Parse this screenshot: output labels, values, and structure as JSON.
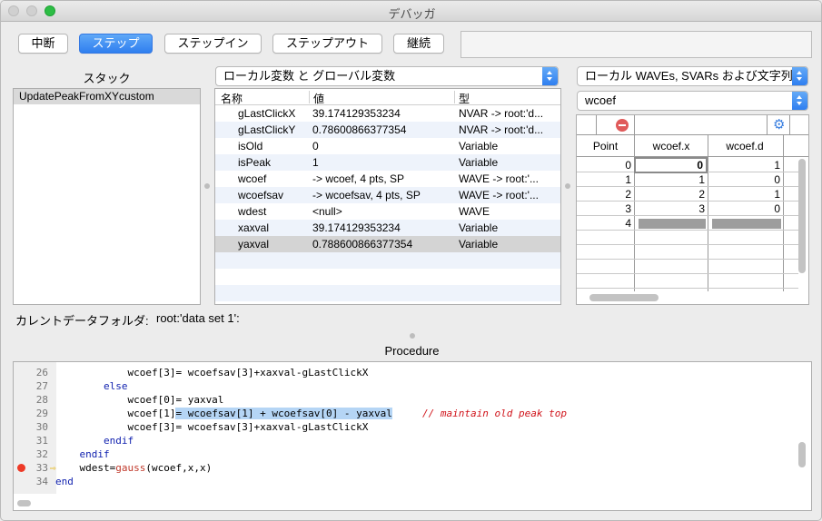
{
  "window": {
    "title": "デバッガ"
  },
  "toolbar": {
    "break_label": "中断",
    "step_label": "ステップ",
    "step_in_label": "ステップイン",
    "step_out_label": "ステップアウト",
    "continue_label": "継続",
    "message": ""
  },
  "stack": {
    "title": "スタック",
    "items": [
      "UpdatePeakFromXYcustom"
    ]
  },
  "variables": {
    "scope_popup": "ローカル変数 と グローバル変数",
    "columns": {
      "name": "名称",
      "value": "値",
      "type": "型"
    },
    "rows": [
      {
        "name": "gLastClickX",
        "value": "39.174129353234",
        "type": "NVAR -> root:'d..."
      },
      {
        "name": "gLastClickY",
        "value": "0.78600866377354",
        "type": "NVAR -> root:'d..."
      },
      {
        "name": "isOld",
        "value": "0",
        "type": "Variable"
      },
      {
        "name": "isPeak",
        "value": "1",
        "type": "Variable"
      },
      {
        "name": "wcoef",
        "value": "-> wcoef, 4 pts, SP",
        "type": "WAVE -> root:'..."
      },
      {
        "name": "wcoefsav",
        "value": "-> wcoefsav, 4 pts, SP",
        "type": "WAVE -> root:'..."
      },
      {
        "name": "wdest",
        "value": "<null>",
        "type": "WAVE"
      },
      {
        "name": "xaxval",
        "value": "39.174129353234",
        "type": "Variable"
      },
      {
        "name": "yaxval",
        "value": "0.788600866377354",
        "type": "Variable"
      }
    ],
    "selected_index": 8
  },
  "waves": {
    "type_popup": "ローカル WAVEs, SVARs および文字列",
    "wave_popup": "wcoef",
    "headers": [
      "Point",
      "wcoef.x",
      "wcoef.d"
    ],
    "rows": [
      [
        "0",
        "0",
        "1"
      ],
      [
        "1",
        "1",
        "0"
      ],
      [
        "2",
        "2",
        "1"
      ],
      [
        "3",
        "3",
        "0"
      ],
      [
        "4",
        "",
        ""
      ]
    ],
    "toolbar_icons": [
      "no-entry-icon",
      "gear-icon"
    ]
  },
  "current_folder": {
    "label": "カレントデータフォルダ:",
    "value": "root:'data set 1':"
  },
  "procedure": {
    "title": "Procedure",
    "breakpoint_line": "33",
    "current_line": "33",
    "lines": [
      {
        "n": "26",
        "parts": [
          [
            "",
            "            wcoef[3]= wcoefsav[3]+xaxval-gLastClickX"
          ]
        ]
      },
      {
        "n": "27",
        "parts": [
          [
            "",
            "        "
          ],
          [
            "kw",
            "else"
          ]
        ]
      },
      {
        "n": "28",
        "parts": [
          [
            "",
            "            wcoef[0]= yaxval"
          ]
        ]
      },
      {
        "n": "29",
        "parts": [
          [
            "",
            "            wcoef[1]"
          ],
          [
            "hl",
            "= wcoefsav[1] + wcoefsav[0] - yaxval"
          ],
          [
            "",
            "     "
          ],
          [
            "cm",
            "// maintain old peak top"
          ]
        ]
      },
      {
        "n": "30",
        "parts": [
          [
            "",
            "            wcoef[3]= wcoefsav[3]+xaxval-gLastClickX"
          ]
        ]
      },
      {
        "n": "31",
        "parts": [
          [
            "",
            "        "
          ],
          [
            "kw",
            "endif"
          ]
        ]
      },
      {
        "n": "32",
        "parts": [
          [
            "",
            "    "
          ],
          [
            "kw",
            "endif"
          ]
        ]
      },
      {
        "n": "33",
        "parts": [
          [
            "",
            "    wdest="
          ],
          [
            "fn",
            "gauss"
          ],
          [
            "",
            "(wcoef,x,x)"
          ]
        ]
      },
      {
        "n": "34",
        "parts": [
          [
            "kw",
            "end"
          ]
        ]
      }
    ]
  },
  "colors": {
    "accent": "#2f7fef",
    "selection": "#d4d4d4",
    "highlight": "#b5d5f5",
    "breakpoint": "#ee3a27",
    "keyword": "#0e1fae",
    "comment": "#d0131a"
  }
}
